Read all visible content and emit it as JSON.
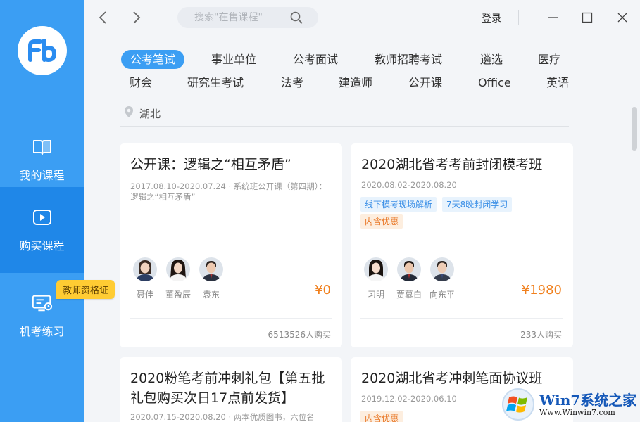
{
  "sidebar": {
    "items": [
      {
        "label": "我的课程",
        "icon": "book-icon"
      },
      {
        "label": "购买课程",
        "icon": "play-icon"
      },
      {
        "label": "机考练习",
        "icon": "computer-icon"
      }
    ],
    "badge": "教师资格证"
  },
  "topbar": {
    "search_placeholder": "搜索\"在售课程\"",
    "login_label": "登录"
  },
  "categories": {
    "row1": [
      "公考笔试",
      "事业单位",
      "公考面试",
      "教师招聘考试",
      "遴选",
      "医疗"
    ],
    "row2": [
      "财会",
      "研究生考试",
      "法考",
      "建造师",
      "公开课",
      "Office",
      "英语"
    ]
  },
  "location": "湖北",
  "courses": [
    {
      "title": "公开课：逻辑之“相互矛盾”",
      "subtitle": "2017.08.10-2020.07.24 · 系统班公开课（第四期）：逻辑之“相互矛盾”",
      "tags": [],
      "teachers": [
        "聂佳",
        "董盈辰",
        "袁东"
      ],
      "price": "¥0",
      "buyers": "6513526人购买"
    },
    {
      "title": "2020湖北省考考前封闭模考班",
      "subtitle": "2020.08.02-2020.08.20",
      "tags": [
        "线下模考现场解析",
        "7天8晚封闭学习"
      ],
      "promo": "内含优惠",
      "teachers": [
        "习明",
        "贾慕白",
        "向东平"
      ],
      "price": "¥1980",
      "buyers": "233人购买"
    },
    {
      "title": "2020粉笔考前冲刺礼包【第五批礼包购买次日17点前发货】",
      "subtitle": "2020.07.15-2020.08.20 · 两本优质图书，六位名"
    },
    {
      "title": "2020湖北省考冲刺笔面协议班",
      "subtitle": "2019.12.02-2020.06.10",
      "promo": "内含优惠"
    }
  ],
  "watermark": {
    "title": "Win7系统之家",
    "url": "Www.Winwin7.com"
  },
  "colors": {
    "sidebar": "#3b9ef3",
    "sidebar_active": "#1f87e8",
    "accent": "#3b9ef3",
    "price": "#f0801e",
    "badge": "#ffcc33"
  }
}
